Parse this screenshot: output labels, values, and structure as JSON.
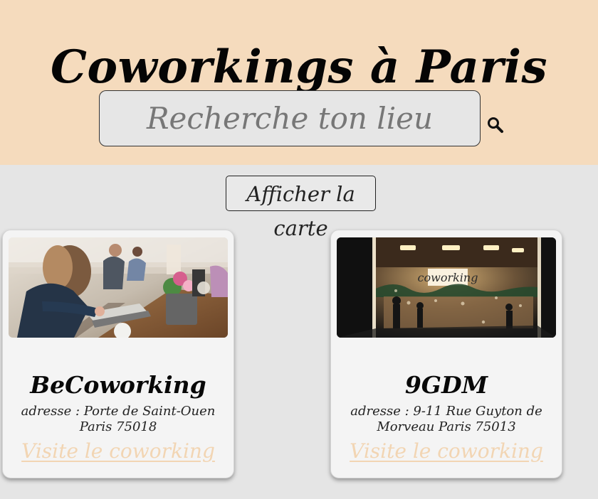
{
  "header": {
    "title": "Coworkings à Paris",
    "search": {
      "placeholder": "Recherche ton lieu",
      "value": ""
    },
    "search_icon": "search-icon"
  },
  "map_button": {
    "label": "Afficher la carte"
  },
  "cards": [
    {
      "title": "BeCoworking",
      "address": "adresse : Porte de Saint-Ouen Paris 75018",
      "link_label": "Visite le coworking"
    },
    {
      "title": "9GDM",
      "address": "adresse : 9-11 Rue Guyton de Morveau Paris 75013",
      "link_label": "Visite le coworking",
      "image_sign": "coworking"
    }
  ],
  "colors": {
    "header_background": "#f5dbbd",
    "page_background": "#e5e5e5",
    "card_background": "#f4f4f4",
    "link": "#f2d5b3"
  }
}
